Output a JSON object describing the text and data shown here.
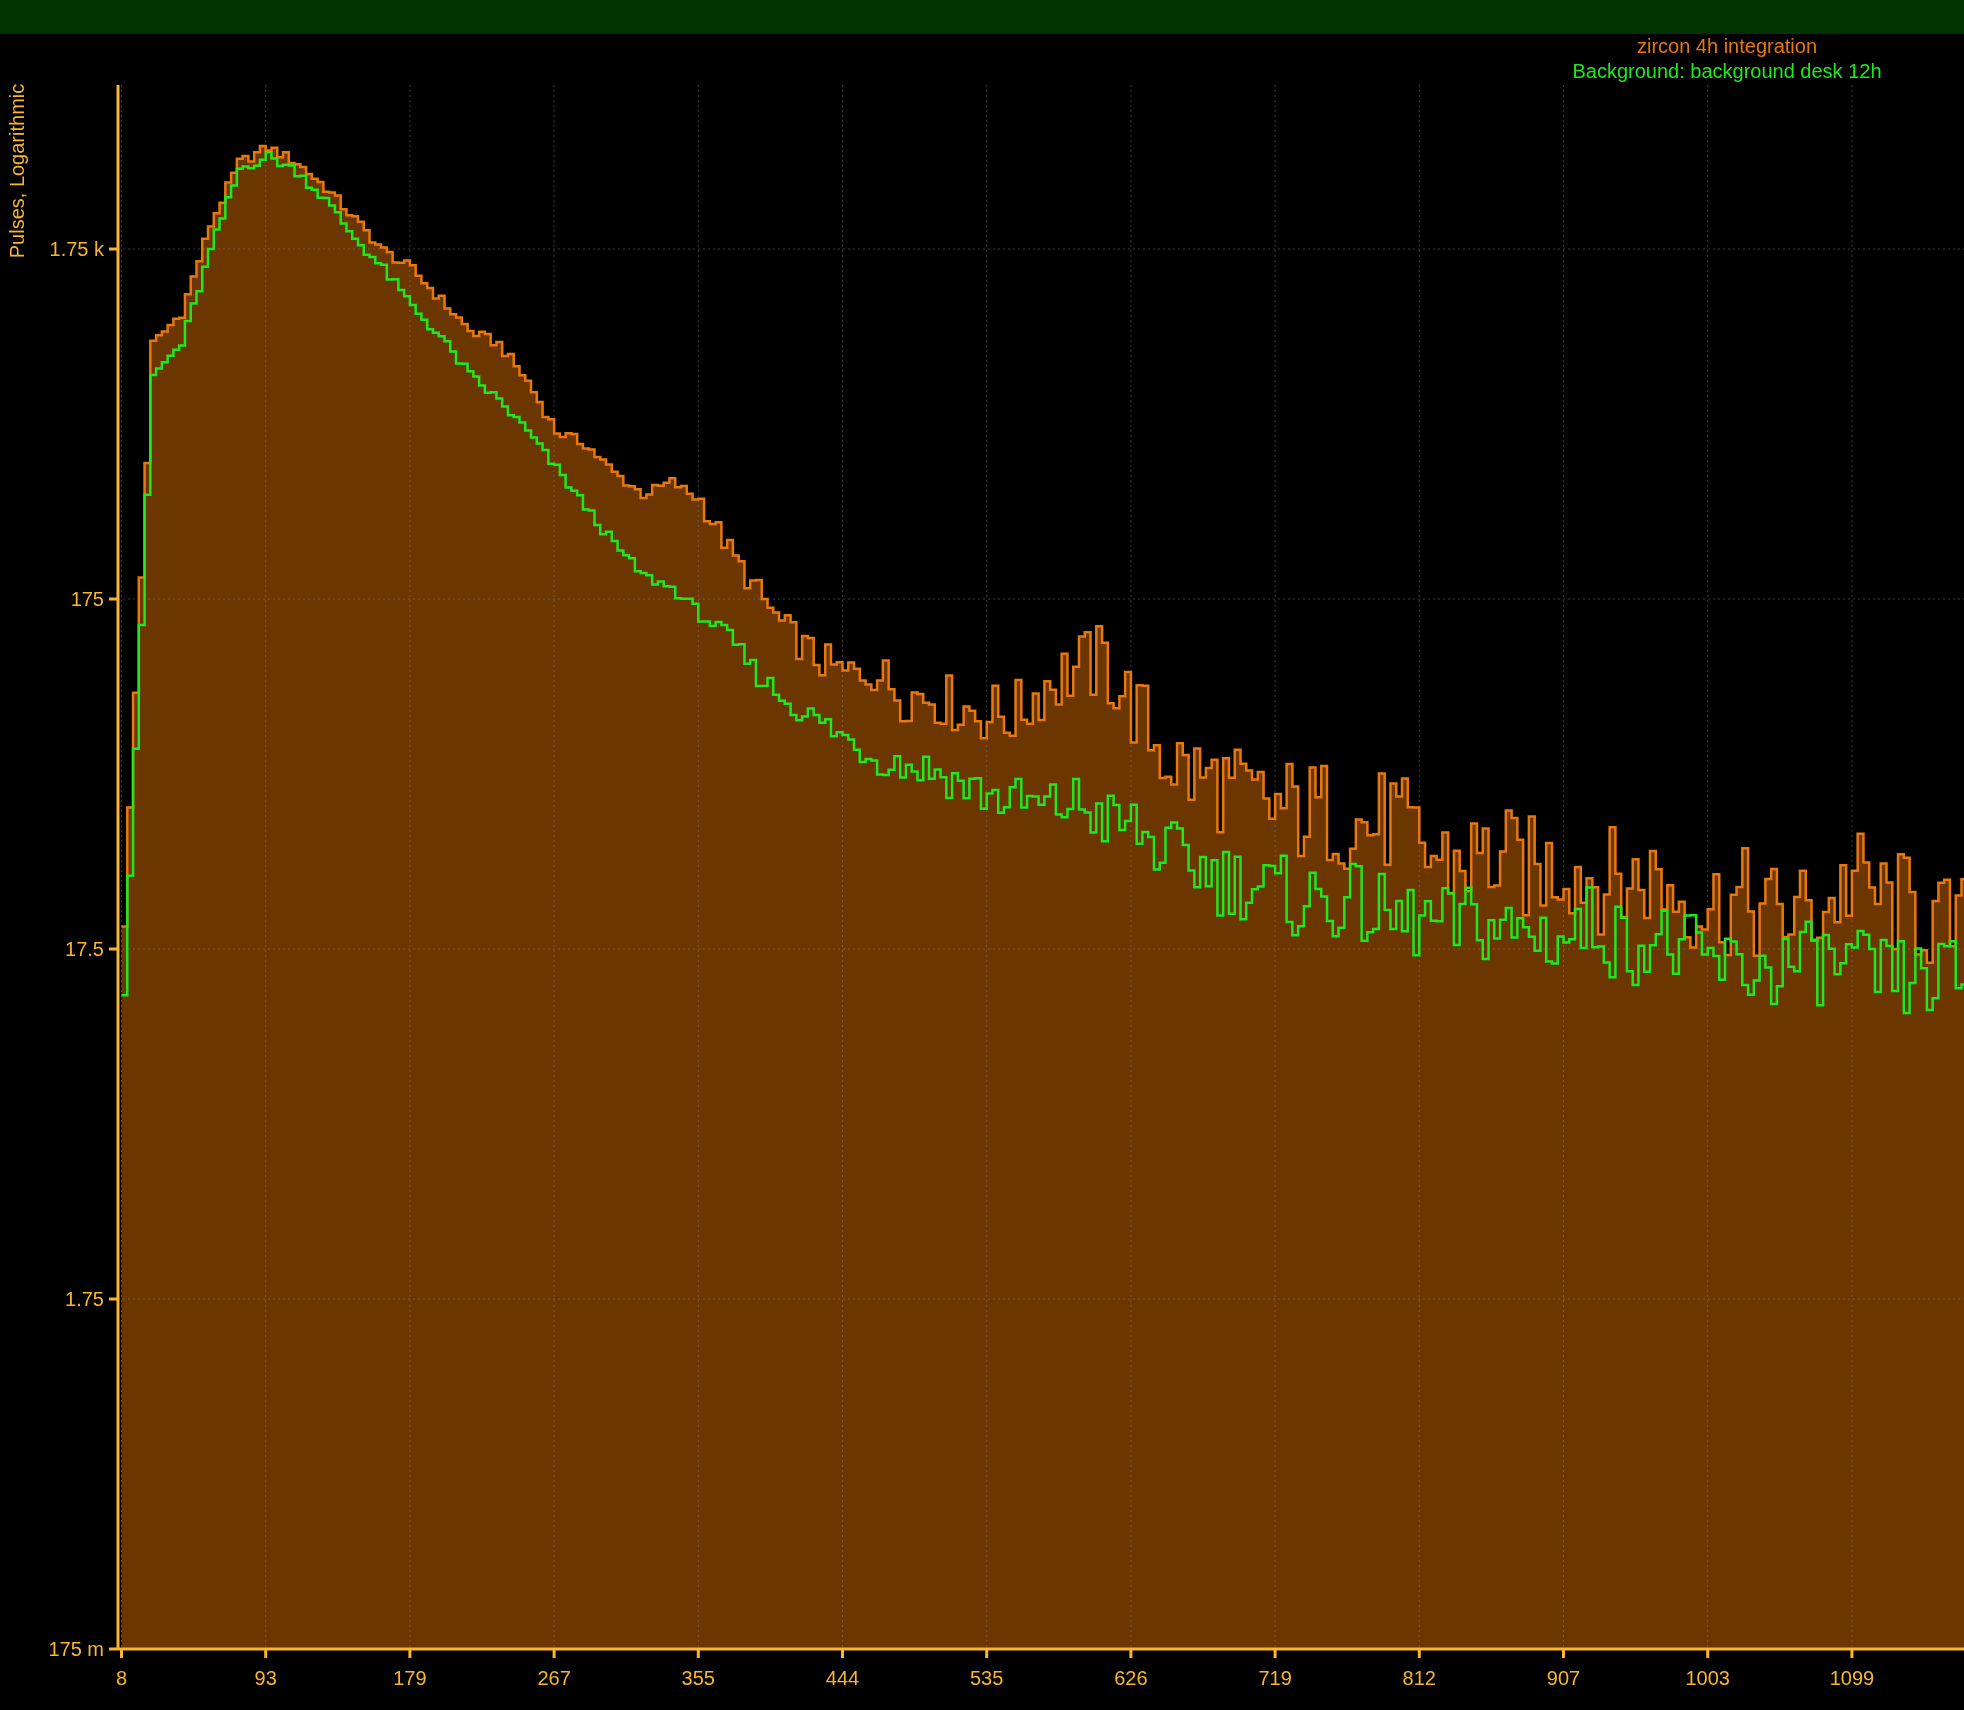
{
  "chart": {
    "y_axis_title": "Pulses, Logarithmic",
    "y_tick_labels": [
      "1.75 k",
      "175",
      "17.5",
      "1.75",
      "175 m"
    ],
    "x_tick_labels": [
      "8",
      "93",
      "179",
      "267",
      "355",
      "444",
      "535",
      "626",
      "719",
      "812",
      "907",
      "1003",
      "1099"
    ],
    "legend": [
      {
        "label": "zircon 4h integration",
        "color": "#e8780c"
      },
      {
        "label": "Background: background desk 12h",
        "color": "#1ee81e"
      }
    ]
  }
}
